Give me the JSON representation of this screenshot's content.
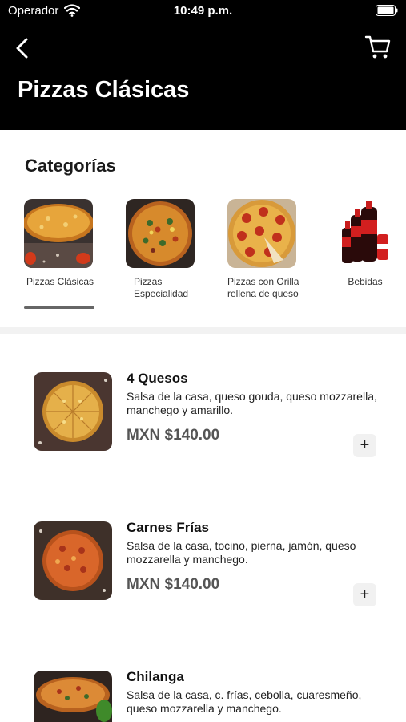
{
  "status_bar": {
    "carrier": "Operador",
    "time": "10:49 p.m."
  },
  "header": {
    "title": "Pizzas Clásicas"
  },
  "categories_section": {
    "title": "Categorías",
    "items": [
      {
        "label": "Pizzas Clásicas",
        "selected": true
      },
      {
        "label": "Pizzas Especialidad",
        "selected": false
      },
      {
        "label": "Pizzas con Orilla rellena de queso",
        "selected": false
      },
      {
        "label": "Bebidas",
        "selected": false
      }
    ]
  },
  "products": [
    {
      "name": "4 Quesos",
      "description": "Salsa de la casa, queso gouda, queso mozzarella, manchego y amarillo.",
      "price": "MXN $140.00",
      "add_label": "+"
    },
    {
      "name": "Carnes Frías",
      "description": "Salsa de la casa, tocino, pierna, jamón, queso mozzarella y manchego.",
      "price": "MXN $140.00",
      "add_label": "+"
    },
    {
      "name": "Chilanga",
      "description": "Salsa de la casa, c. frías, cebolla, cuaresmeño, queso mozzarella y manchego.",
      "price": "",
      "add_label": ""
    }
  ],
  "colors": {
    "header_bg": "#000000",
    "price_text": "#555555",
    "add_button_bg": "#f1f1f1"
  },
  "icons": [
    "wifi-icon",
    "battery-icon",
    "back-chevron-icon",
    "cart-icon",
    "plus-icon"
  ]
}
